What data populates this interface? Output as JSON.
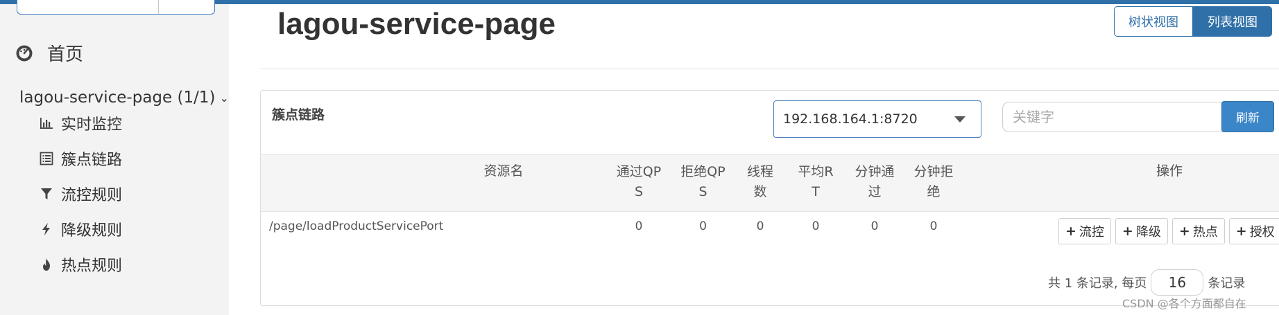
{
  "sidebar": {
    "home_label": "首页",
    "app_label": "lagou-service-page",
    "app_count": "(1/1)",
    "items": [
      {
        "label": "实时监控",
        "icon": "bar-chart-icon"
      },
      {
        "label": "簇点链路",
        "icon": "list-icon"
      },
      {
        "label": "流控规则",
        "icon": "filter-icon"
      },
      {
        "label": "降级规则",
        "icon": "bolt-icon"
      },
      {
        "label": "热点规则",
        "icon": "fire-icon"
      }
    ]
  },
  "header": {
    "title": "lagou-service-page",
    "tree_view_label": "树状视图",
    "list_view_label": "列表视图"
  },
  "panel": {
    "title": "簇点链路",
    "machine_value": "192.168.164.1:8720",
    "keyword_placeholder": "关键字",
    "refresh_label": "刷新",
    "columns": [
      [
        "资源名"
      ],
      [
        "通过QP",
        "S"
      ],
      [
        "拒绝QP",
        "S"
      ],
      [
        "线程",
        "数"
      ],
      [
        "平均R",
        "T"
      ],
      [
        "分钟通",
        "过"
      ],
      [
        "分钟拒",
        "绝"
      ],
      [
        "操作"
      ]
    ],
    "rows": [
      {
        "resource": "/page/loadProductServicePort",
        "pass_qps": "0",
        "block_qps": "0",
        "threads": "0",
        "avg_rt": "0",
        "minute_pass": "0",
        "minute_block": "0"
      }
    ],
    "actions": [
      "流控",
      "降级",
      "热点",
      "授权"
    ],
    "pager": {
      "prefix": "共 1 条记录, 每页",
      "page_size": "16",
      "suffix": "条记录"
    }
  },
  "watermark": "CSDN @各个方面都自在",
  "colors": {
    "primary": "#2f70a9",
    "refresh": "#3a86c8",
    "sidebar_bg": "#f3f3f3"
  }
}
